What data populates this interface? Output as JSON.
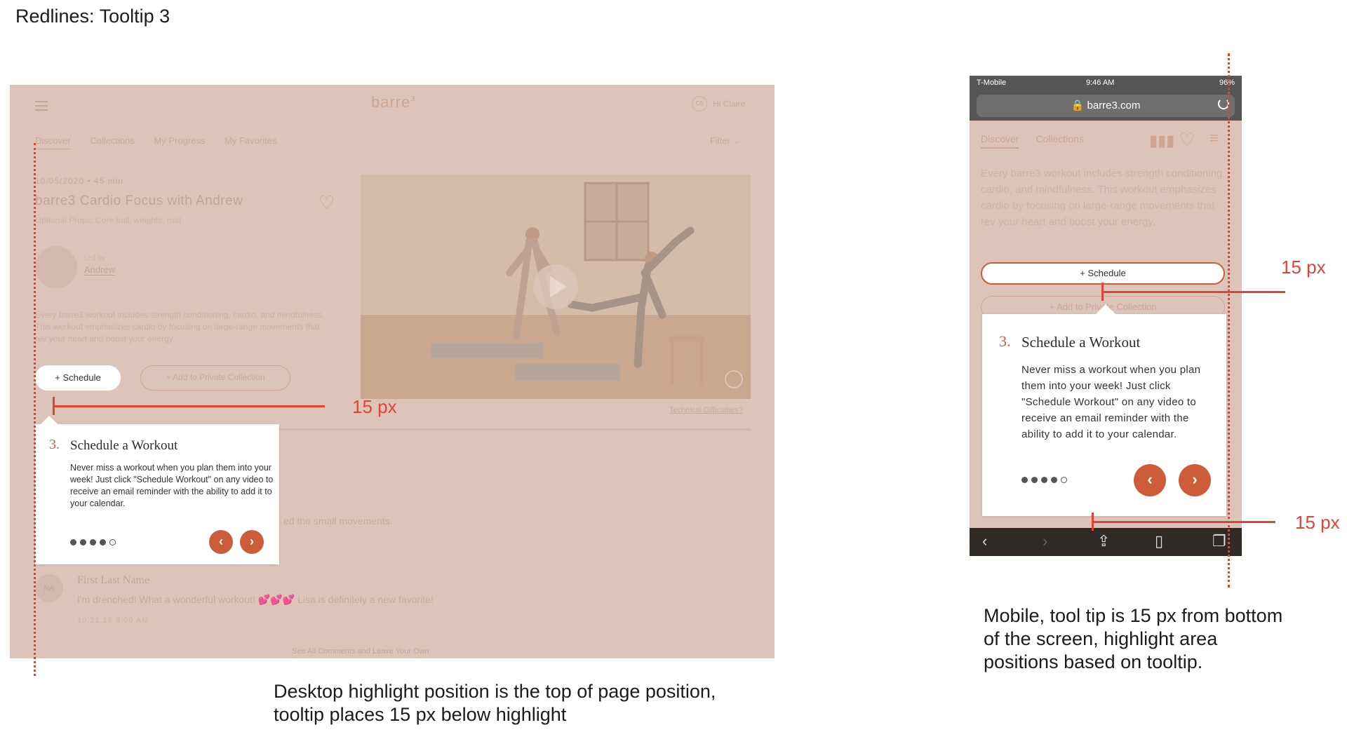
{
  "page_title": "Redlines: Tooltip 3",
  "desktop": {
    "logo": "barre",
    "logo_sup": "3",
    "avatar_initials": "CS",
    "greeting": "Hi Claire",
    "nav": [
      "Discover",
      "Collections",
      "My Progress",
      "My Favorites"
    ],
    "filter_label": "Filter",
    "meta": "10/05/2020  •  45 min",
    "workout_title": "barre3 Cardio Focus with Andrew",
    "props": "Optional Props: Core ball, weights, mat",
    "led_by_label": "Led by",
    "instructor": "Andrew",
    "description": "Every barre3 workout includes strength conditioning, cardio, and mindfulness. This workout emphasizes cardio by focusing on large-range movements that rev your heart and boost your energy.",
    "schedule_label": "+   Schedule",
    "private_label": "+   Add to Private Collection",
    "tech_link": "Technical Difficulties?",
    "comment_tail": "ed the small movements.",
    "commenter_initials": "NA",
    "commenter_name": "First Last Name",
    "comment_text": "I'm drenched! What a wonderful workout! 💕💕💕 Lisa is definitely a new favorite!",
    "comment_time": "10.21.18   9:00 AM",
    "see_all": "See All Comments and Leave Your Own",
    "tooltip": {
      "number": "3.",
      "title": "Schedule a Workout",
      "body": "Never miss a workout when you plan them into your week! Just click \"Schedule Workout\" on any video to receive an email reminder with the ability to add it to your calendar.",
      "prev": "‹",
      "next": "›"
    },
    "redline_label": "15 px",
    "caption": "Desktop highlight position is the top of page position, tooltip places 15 px below highlight"
  },
  "mobile": {
    "carrier": "T-Mobile",
    "time": "9:46 AM",
    "battery": "96%",
    "url": "barre3.com",
    "nav": [
      "Discover",
      "Collections"
    ],
    "description": "Every barre3 workout includes strength conditioning, cardio, and mindfulness. This workout emphasizes cardio by focusing on large-range movements that rev your heart and boost your energy.",
    "schedule_label": "+  Schedule",
    "private_label": "+  Add to Private Collection",
    "tooltip": {
      "number": "3.",
      "title": "Schedule a Workout",
      "body": "Never miss a workout when you plan them into your week! Just click \"Schedule Workout\" on any video to receive an email reminder with the ability to add it to your calendar.",
      "prev": "‹",
      "next": "›"
    },
    "redline_label_top": "15 px",
    "redline_label_bottom": "15 px",
    "caption": "Mobile, tool tip is 15 px from bottom of the screen, highlight area positions based on tooltip."
  },
  "colors": {
    "accent": "#cd5d3a",
    "redline": "#e0433a",
    "overlay": "#dcc5b8"
  }
}
